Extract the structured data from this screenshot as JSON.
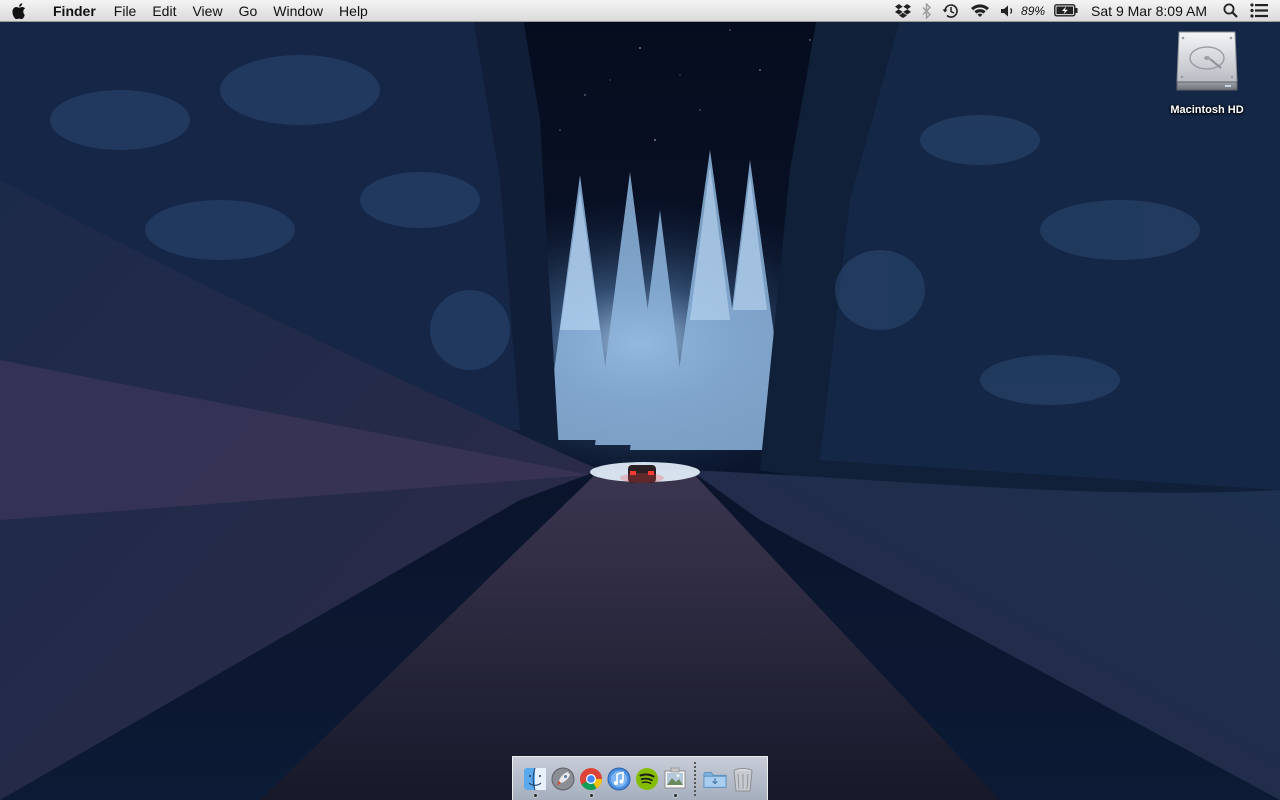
{
  "menubar": {
    "apple_icon": "apple-logo-icon",
    "app_name": "Finder",
    "menus": [
      "File",
      "Edit",
      "View",
      "Go",
      "Window",
      "Help"
    ],
    "status_icons": [
      "dropbox-icon",
      "bluetooth-icon",
      "time-machine-icon",
      "wifi-icon",
      "volume-icon"
    ],
    "battery_percent": "89%",
    "battery_icon": "battery-charging-icon",
    "clock": "Sat 9 Mar  8:09 AM",
    "spotlight_icon": "spotlight-search-icon",
    "notification_icon": "notification-center-icon"
  },
  "desktop": {
    "wallpaper": "snowy-forest-road-night",
    "icons": [
      {
        "label": "Macintosh HD",
        "icon": "hard-drive-icon"
      }
    ]
  },
  "dock": {
    "items": [
      {
        "name": "Finder",
        "icon": "finder-icon",
        "running": true
      },
      {
        "name": "Launchpad",
        "icon": "launchpad-icon",
        "running": false
      },
      {
        "name": "Google Chrome",
        "icon": "chrome-icon",
        "running": true
      },
      {
        "name": "iTunes",
        "icon": "itunes-icon",
        "running": false
      },
      {
        "name": "Spotify",
        "icon": "spotify-icon",
        "running": false
      },
      {
        "name": "Preview",
        "icon": "preview-icon",
        "running": true
      },
      {
        "name": "Downloads",
        "icon": "folder-icon",
        "running": false
      },
      {
        "name": "Trash",
        "icon": "trash-icon",
        "running": false
      }
    ]
  }
}
